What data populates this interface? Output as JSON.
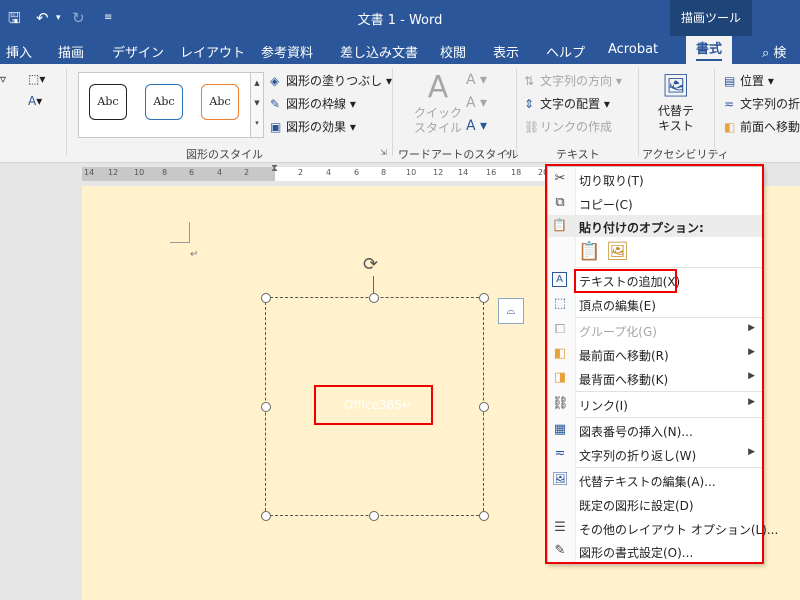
{
  "titlebar": {
    "title": "文書 1  -  Word",
    "context_tab_title": "描画ツール",
    "save_icon": "save-icon",
    "undo_icon": "undo-icon",
    "redo_icon": "redo-icon",
    "customize_icon": "customize-qat-icon"
  },
  "tabs": [
    "挿入",
    "描画",
    "デザイン",
    "レイアウト",
    "参考資料",
    "差し込み文書",
    "校閲",
    "表示",
    "ヘルプ",
    "Acrobat",
    "書式",
    "検"
  ],
  "active_tab": "書式",
  "ribbon": {
    "shape_styles": {
      "sample_text": "Abc",
      "fill": "図形の塗りつぶし",
      "outline": "図形の枠線",
      "effects": "図形の効果",
      "group_label": "図形のスタイル"
    },
    "wordart": {
      "quick_style_line1": "クイック",
      "quick_style_line2": "スタイル",
      "group_label": "ワードアートのスタイル"
    },
    "text": {
      "direction": "文字列の方向",
      "align": "文字の配置",
      "link": "リンクの作成",
      "group_label": "テキスト"
    },
    "accessibility": {
      "alt_text_line1": "代替テ",
      "alt_text_line2": "キスト",
      "group_label": "アクセシビリティ"
    },
    "arrange": {
      "position": "位置",
      "wrap": "文字列の折",
      "bring_forward": "前面へ移動"
    }
  },
  "ruler": {
    "numbers": [
      "14",
      "12",
      "10",
      "8",
      "6",
      "4",
      "2",
      "2",
      "4",
      "6",
      "8",
      "10",
      "12",
      "14",
      "16",
      "18",
      "20"
    ]
  },
  "document": {
    "paragraph_mark": "↵",
    "shape_text": "Office365↵"
  },
  "context_menu": {
    "cut": "切り取り(T)",
    "copy": "コピー(C)",
    "paste_header": "貼り付けのオプション:",
    "add_text": "テキストの追加(X)",
    "edit_points": "頂点の編集(E)",
    "group": "グループ化(G)",
    "bring_to_front": "最前面へ移動(R)",
    "send_to_back": "最背面へ移動(K)",
    "link": "リンク(I)",
    "insert_caption": "図表番号の挿入(N)...",
    "wrap_text": "文字列の折り返し(W)",
    "edit_alt_text": "代替テキストの編集(A)...",
    "set_default": "既定の図形に設定(D)",
    "more_layout": "その他のレイアウト オプション(L)...",
    "format_shape": "図形の書式設定(O)..."
  },
  "colors": {
    "word_blue": "#2b579a",
    "highlight_red": "#e00000",
    "page_bg": "#fff2cc"
  }
}
